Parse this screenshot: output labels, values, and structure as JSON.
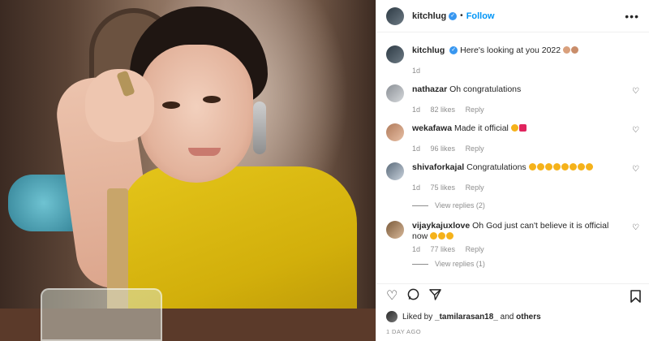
{
  "post": {
    "username": "kitchlug",
    "follow_label": "Follow",
    "more_label": "•••",
    "caption": "Here's looking at you 2022",
    "caption_time": "1d"
  },
  "comments": [
    {
      "username": "nathazar",
      "text": "Oh congratulations",
      "time": "1d",
      "likes": "82 likes",
      "reply": "Reply"
    },
    {
      "username": "wekafawa",
      "text": "Made it official",
      "time": "1d",
      "likes": "96 likes",
      "reply": "Reply"
    },
    {
      "username": "shivaforkajal",
      "text": "Congratulations",
      "time": "1d",
      "likes": "75 likes",
      "reply": "Reply",
      "view_replies": "View replies (2)"
    },
    {
      "username": "vijaykajuxlove",
      "text": "Oh God just can't believe it is official now",
      "time": "1d",
      "likes": "77 likes",
      "reply": "Reply",
      "view_replies": "View replies (1)"
    }
  ],
  "likes_line": {
    "prefix": "Liked by",
    "user": "_tamilarasan18_",
    "and": "and",
    "others": "others"
  },
  "timestamp": "1 DAY AGO",
  "icons": [
    "heart-icon",
    "comment-icon",
    "share-icon",
    "bookmark-icon",
    "verified-icon",
    "more-icon"
  ],
  "colors": {
    "link_blue": "#0095f6",
    "verified_blue": "#3897f0",
    "muted": "#8e8e8e",
    "shirt_yellow": "#d8b511"
  }
}
